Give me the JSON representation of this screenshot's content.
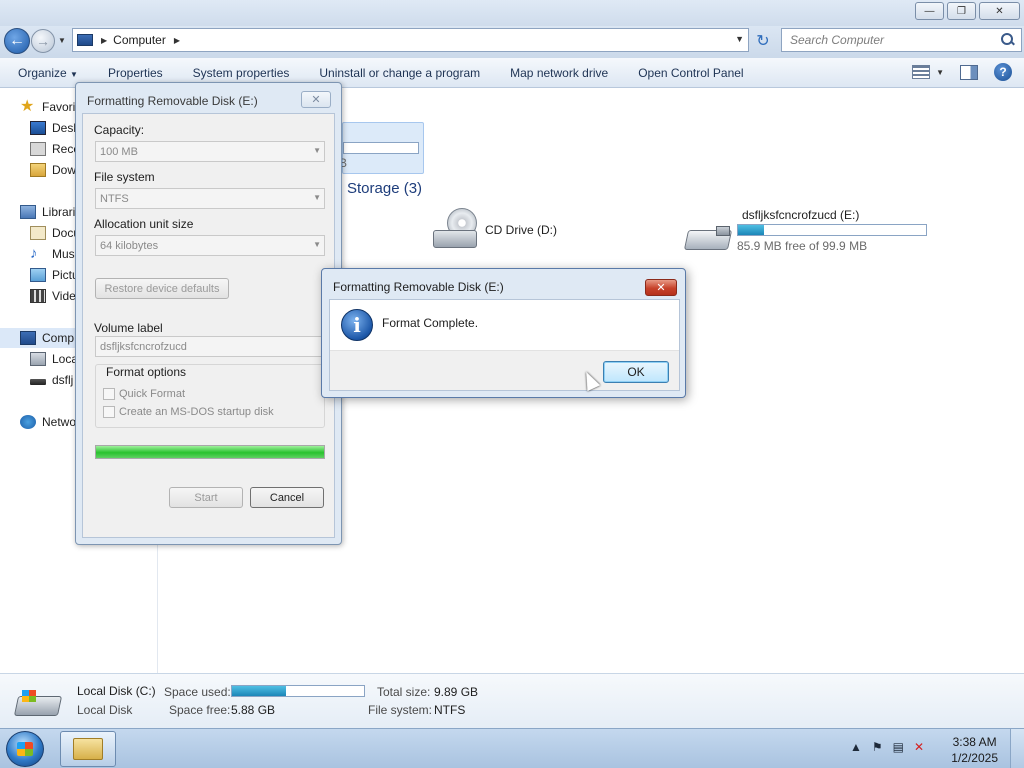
{
  "explorer": {
    "address": {
      "location": "Computer"
    },
    "search": {
      "placeholder": "Search Computer"
    },
    "toolbar": {
      "items": [
        "Organize",
        "Properties",
        "System properties",
        "Uninstall or change a program",
        "Map network drive",
        "Open Control Panel"
      ]
    },
    "nav": {
      "favorites": "Favorit",
      "favorites_items": [
        "Desk",
        "Rece",
        "Dow"
      ],
      "libraries": "Librari",
      "libraries_items": [
        "Docu",
        "Mus",
        "Pictu",
        "Vide"
      ],
      "computer": "Comp",
      "computer_items": [
        "Loca",
        "dsflj"
      ],
      "network": "Netwo"
    },
    "content": {
      "partial_tile_text": "B",
      "group_header": "Storage (3)",
      "cd_drive": {
        "name": "CD Drive (D:)"
      },
      "usb_drive": {
        "name": "dsfljksfcncrofzucd (E:)",
        "free_text": "85.9 MB free of 99.9 MB",
        "used_fraction": 0.14
      }
    },
    "details": {
      "name": "Local Disk (C:)",
      "type": "Local Disk",
      "space_used_label": "Space used:",
      "space_used_fraction": 0.41,
      "space_free_label": "Space free:",
      "space_free": "5.88 GB",
      "total_size_label": "Total size:",
      "total_size": "9.89 GB",
      "file_system_label": "File system:",
      "file_system": "NTFS"
    }
  },
  "format_dialog": {
    "title": "Formatting Removable Disk (E:)",
    "capacity_label": "Capacity:",
    "capacity_value": "100 MB",
    "file_system_label": "File system",
    "file_system_value": "NTFS",
    "allocation_label": "Allocation unit size",
    "allocation_value": "64 kilobytes",
    "restore_label": "Restore device defaults",
    "volume_label_label": "Volume label",
    "volume_label_value": "dsfljksfcncrofzucd",
    "format_options_label": "Format options",
    "quick_format_label": "Quick Format",
    "msdos_label": "Create an MS-DOS startup disk",
    "progress_fraction": 1.0,
    "start_label": "Start",
    "cancel_label": "Cancel"
  },
  "message_box": {
    "title": "Formatting Removable Disk (E:)",
    "text": "Format Complete.",
    "ok_label": "OK"
  },
  "taskbar": {
    "time": "3:38 AM",
    "date": "1/2/2025"
  },
  "colors": {
    "progress_green": "#29c22e",
    "usage_blue": "#1b86b8",
    "close_red": "#c7422a"
  }
}
